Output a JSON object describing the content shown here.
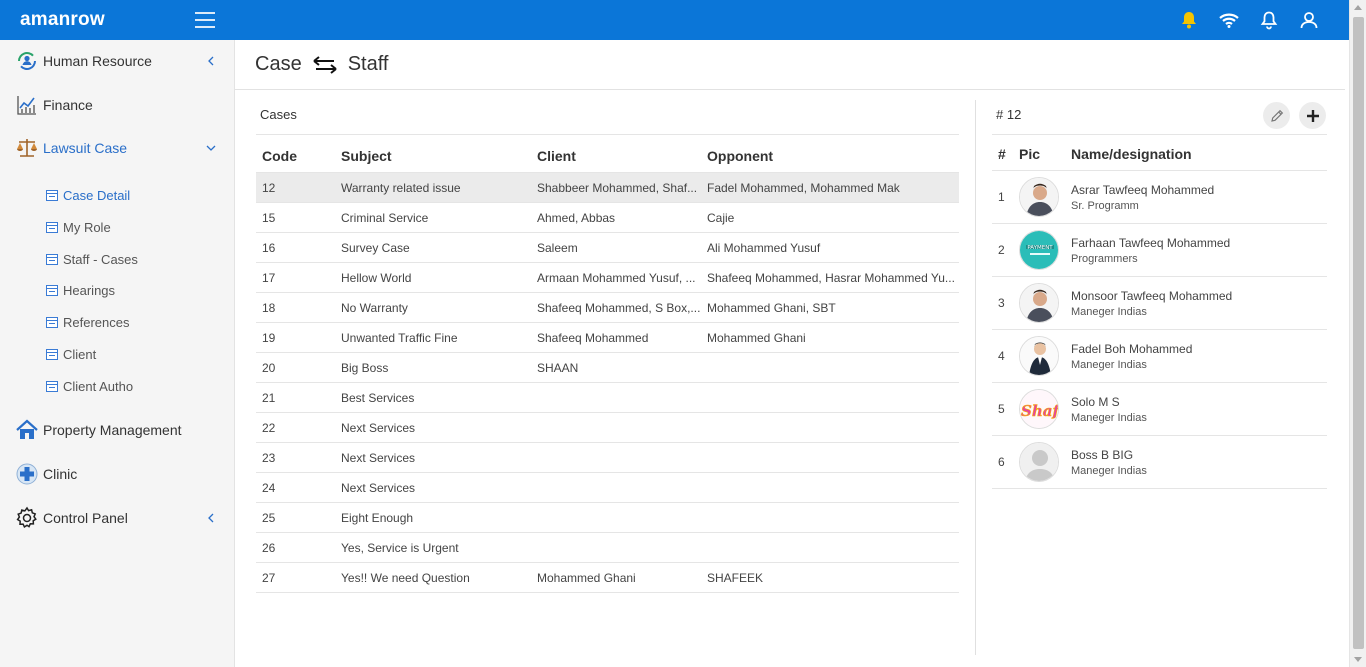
{
  "app": {
    "brand": "amanrow"
  },
  "header": {
    "icons": [
      "bell-filled-icon",
      "wifi-icon",
      "bell-outline-icon",
      "user-icon"
    ],
    "accent": "#0b76d8",
    "bell_color": "#f5c400"
  },
  "sidebar": {
    "items": [
      {
        "label": "Human Resource",
        "icon": "people-icon",
        "chevron": "left"
      },
      {
        "label": "Finance",
        "icon": "chart-icon"
      },
      {
        "label": "Lawsuit Case",
        "icon": "scales-icon",
        "chevron": "down",
        "active": true
      },
      {
        "label": "Property Management",
        "icon": "home-icon"
      },
      {
        "label": "Clinic",
        "icon": "clinic-icon"
      },
      {
        "label": "Control Panel",
        "icon": "gear-icon",
        "chevron": "left"
      }
    ],
    "subitems": [
      {
        "label": "Case Detail",
        "active": true
      },
      {
        "label": "My Role"
      },
      {
        "label": "Staff - Cases"
      },
      {
        "label": "Hearings"
      },
      {
        "label": "References"
      },
      {
        "label": "Client"
      },
      {
        "label": "Client Autho"
      }
    ]
  },
  "page": {
    "title_left": "Case",
    "title_right": "Staff"
  },
  "cases": {
    "title": "Cases",
    "columns": [
      "Code",
      "Subject",
      "Client",
      "Opponent"
    ],
    "rows": [
      [
        "12",
        "Warranty related issue",
        "Shabbeer Mohammed, Shaf...",
        "Fadel Mohammed, Mohammed Mak"
      ],
      [
        "15",
        "Criminal Service",
        "Ahmed, Abbas",
        "Cajie"
      ],
      [
        "16",
        "Survey Case",
        "Saleem",
        "Ali Mohammed Yusuf"
      ],
      [
        "17",
        "Hellow World",
        "Armaan Mohammed Yusuf, ...",
        "Shafeeq Mohammed, Hasrar Mohammed Yu..."
      ],
      [
        "18",
        "No Warranty",
        "Shafeeq Mohammed, S Box,...",
        "Mohammed Ghani, SBT"
      ],
      [
        "19",
        "Unwanted Traffic Fine",
        "Shafeeq Mohammed",
        "Mohammed Ghani"
      ],
      [
        "20",
        "Big Boss",
        "SHAAN",
        ""
      ],
      [
        "21",
        "Best Services",
        "",
        ""
      ],
      [
        "22",
        "Next Services",
        "",
        ""
      ],
      [
        "23",
        "Next Services",
        "",
        ""
      ],
      [
        "24",
        "Next Services",
        "",
        ""
      ],
      [
        "25",
        "Eight Enough",
        "",
        ""
      ],
      [
        "26",
        "Yes, Service is Urgent",
        "",
        ""
      ],
      [
        "27",
        "Yes!! We need Question",
        "Mohammed Ghani",
        "SHAFEEK"
      ]
    ],
    "selected_index": 0
  },
  "staff": {
    "title": "# 12",
    "columns": [
      "#",
      "Pic",
      "Name/designation"
    ],
    "rows": [
      {
        "num": "1",
        "name": "Asrar Tawfeeq Mohammed",
        "designation": "Sr. Programm",
        "avatar": "man-portrait"
      },
      {
        "num": "2",
        "name": "Farhaan Tawfeeq Mohammed",
        "designation": "Programmers",
        "avatar": "teal-logo",
        "avatar_text": "PAYMENT"
      },
      {
        "num": "3",
        "name": "Monsoor Tawfeeq Mohammed",
        "designation": "Maneger Indias",
        "avatar": "man-portrait"
      },
      {
        "num": "4",
        "name": "Fadel Boh Mohammed",
        "designation": "Maneger Indias",
        "avatar": "man-suit"
      },
      {
        "num": "5",
        "name": "Solo M S",
        "designation": "Maneger Indias",
        "avatar": "text-logo",
        "avatar_text": "Shaf"
      },
      {
        "num": "6",
        "name": "Boss B BIG",
        "designation": "Maneger Indias",
        "avatar": "placeholder"
      }
    ]
  }
}
